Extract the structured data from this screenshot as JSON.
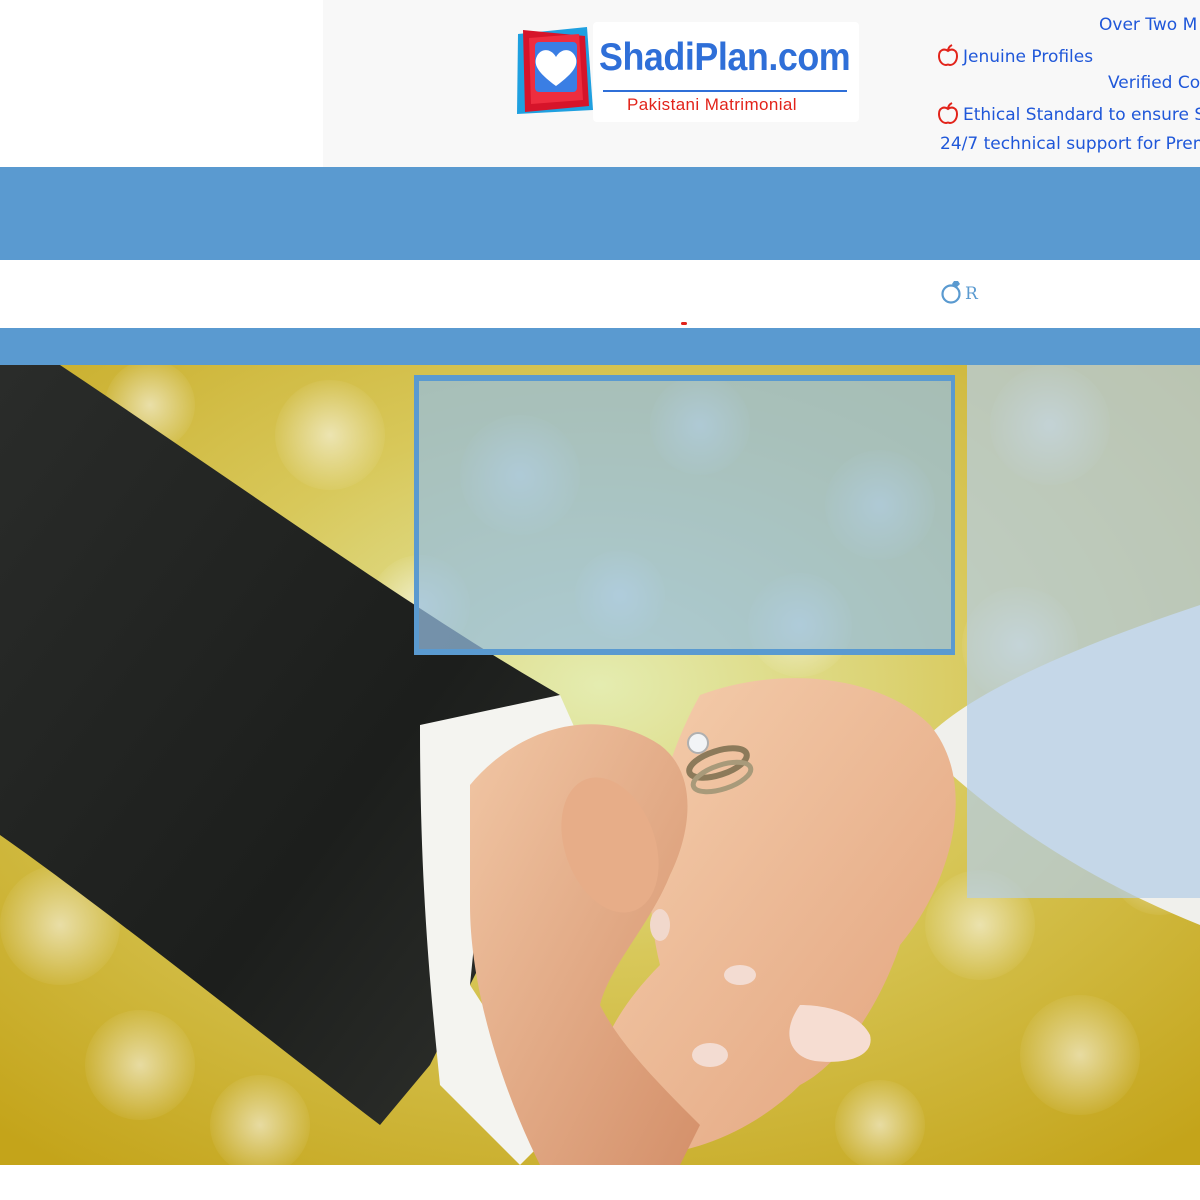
{
  "brand": {
    "name": "ShadiPlan.com",
    "tagline": "Pakistani Matrimonial"
  },
  "features": [
    {
      "text": "Over Two M",
      "icon": ""
    },
    {
      "text": "Jenuine Profiles",
      "icon": "apple-icon"
    },
    {
      "text": "Verified Co",
      "icon": ""
    },
    {
      "text": "Ethical Standard to ensure S",
      "icon": "apple-icon"
    },
    {
      "text": "24/7 technical support for Prem",
      "icon": ""
    }
  ],
  "nav": {
    "item_label": "R",
    "item_icon": "ring-icon"
  },
  "colors": {
    "band": "#5a9ad0",
    "feature_text": "#1f57d9",
    "tagline": "#e2231a",
    "logo_text": "#2f6fd8"
  }
}
